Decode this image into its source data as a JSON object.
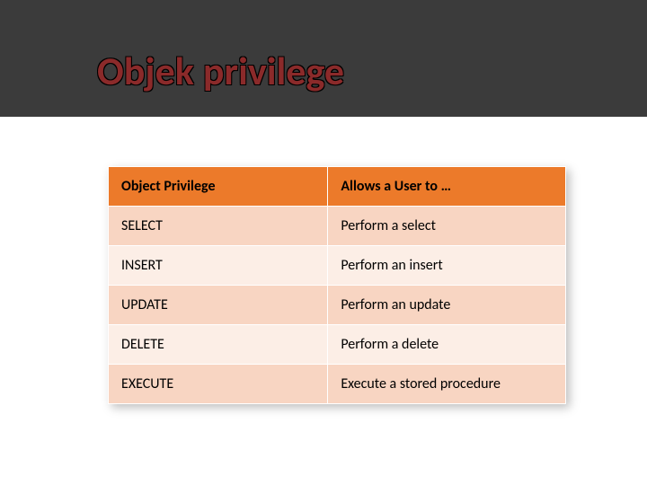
{
  "title": "Objek privilege",
  "table": {
    "headers": [
      "Object Privilege",
      "Allows a User to …"
    ],
    "rows": [
      [
        "SELECT",
        "Perform a select"
      ],
      [
        "INSERT",
        "Perform an insert"
      ],
      [
        "UPDATE",
        "Perform an update"
      ],
      [
        "DELETE",
        "Perform a delete"
      ],
      [
        "EXECUTE",
        "Execute a stored procedure"
      ]
    ]
  }
}
